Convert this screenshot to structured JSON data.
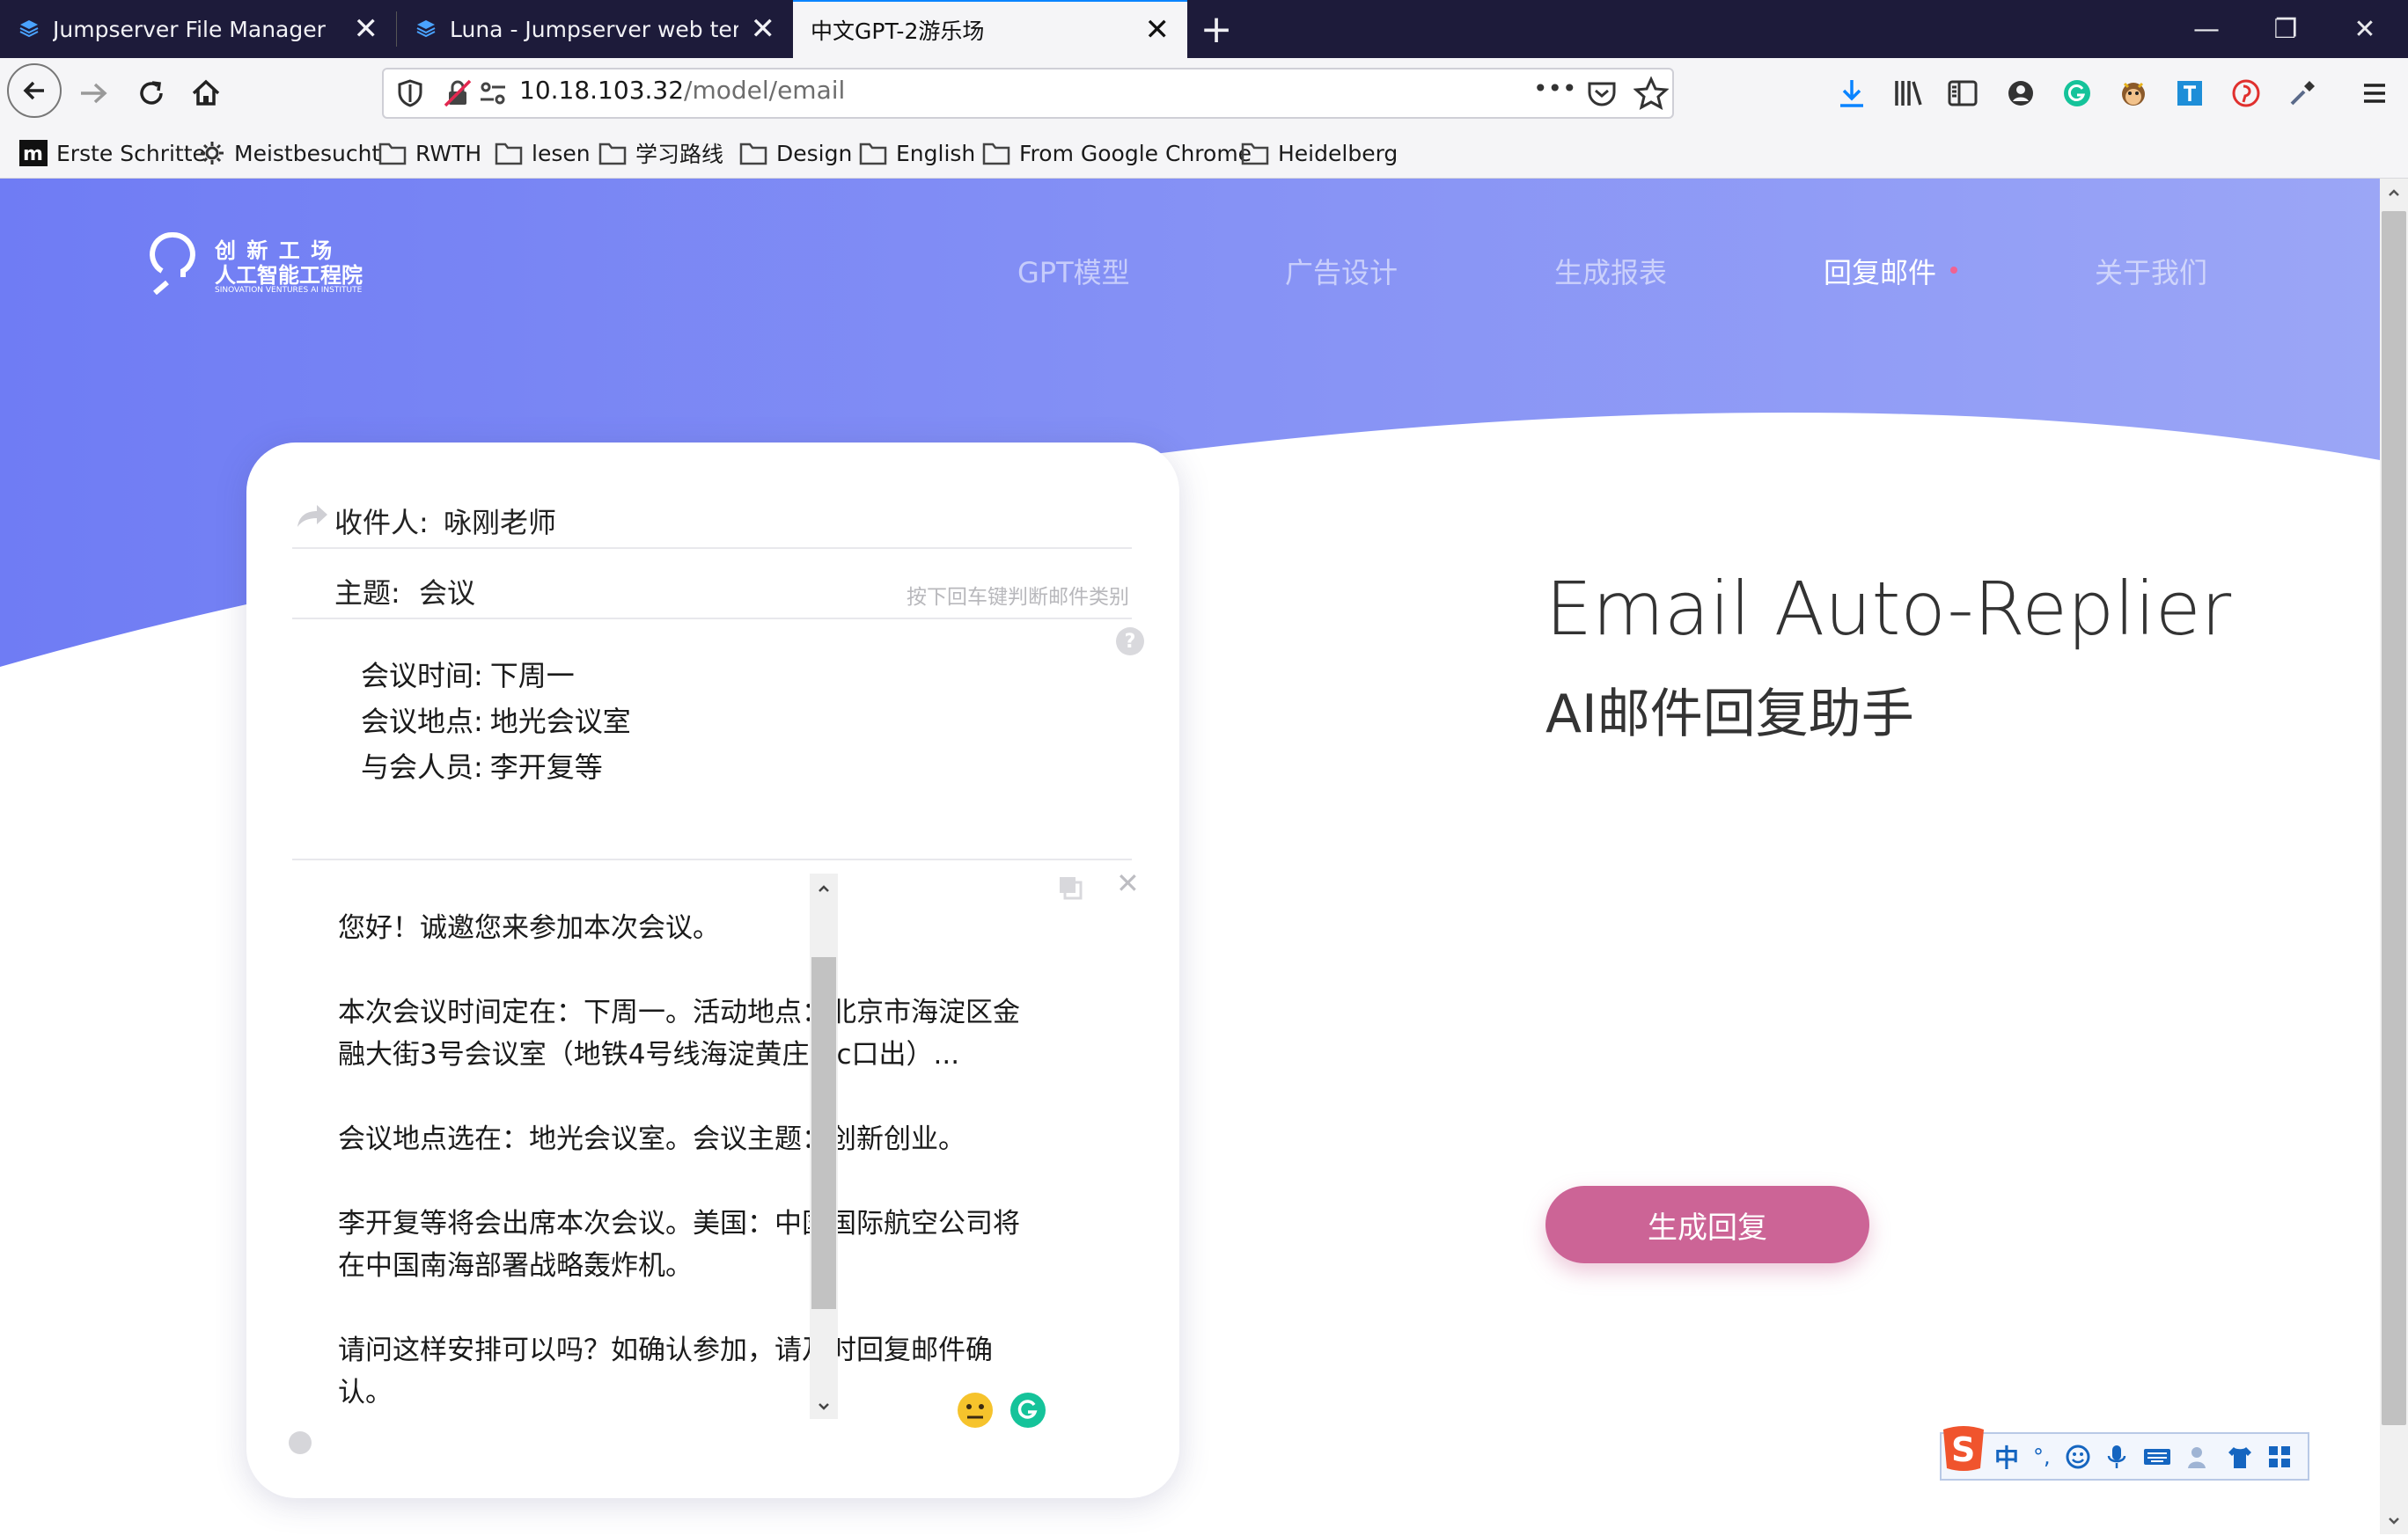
{
  "browser": {
    "tabs": [
      {
        "label": "Jumpserver File Manager",
        "close": "✕",
        "active": false
      },
      {
        "label": "Luna - Jumpserver web terminal",
        "close": "✕",
        "active": false
      },
      {
        "label": "中文GPT-2游乐场",
        "close": "✕",
        "active": true
      }
    ],
    "new_tab": "+",
    "window_controls": {
      "minimize": "—",
      "restore": "❐",
      "close": "✕"
    },
    "url": {
      "host": "10.18.103.32",
      "path": "/model/email"
    },
    "url_more": "•••",
    "bookmarks": [
      {
        "label": "Erste Schritte",
        "icon": "mozilla-icon"
      },
      {
        "label": "Meistbesucht",
        "icon": "gear-icon"
      },
      {
        "label": "RWTH",
        "icon": "folder-icon"
      },
      {
        "label": "lesen",
        "icon": "folder-icon"
      },
      {
        "label": "学习路线",
        "icon": "folder-icon"
      },
      {
        "label": "Design",
        "icon": "folder-icon"
      },
      {
        "label": "English",
        "icon": "folder-icon"
      },
      {
        "label": "From Google Chrome",
        "icon": "folder-icon"
      },
      {
        "label": "Heidelberg",
        "icon": "folder-icon"
      }
    ]
  },
  "site": {
    "logo": {
      "line1": "创 新 工 场",
      "line2": "人工智能工程院",
      "line3": "SINOVATION VENTURES AI INSTITUTE"
    },
    "menu": [
      {
        "label": "GPT模型",
        "active": false
      },
      {
        "label": "广告设计",
        "active": false
      },
      {
        "label": "生成报表",
        "active": false
      },
      {
        "label": "回复邮件",
        "active": true
      },
      {
        "label": "关于我们",
        "active": false
      }
    ],
    "colors": {
      "header_gradient_start": "#6f7cf4",
      "header_gradient_end": "#9ba6f6",
      "button": "#cc6496",
      "active_dot": "#f06292"
    }
  },
  "email": {
    "recipient_label": "收件人:",
    "recipient": "咏刚老师",
    "subject_label": "主题:",
    "subject": "会议",
    "subject_hint": "按下回车键判断邮件类别",
    "help": "?",
    "info_lines": [
      {
        "label": "会议时间:",
        "value": "下周一"
      },
      {
        "label": "会议地点:",
        "value": "地光会议室"
      },
      {
        "label": "与会人员:",
        "value": "李开复等"
      }
    ],
    "reply_lines": [
      "您好！诚邀您来参加本次会议。",
      "",
      "本次会议时间定在：下周一。活动地点：北京市海淀区金",
      "融大街3号会议室（地铁4号线海淀黄庄站c口出）...",
      "",
      "会议地点选在：地光会议室。会议主题：创新创业。",
      "",
      "李开复等将会出席本次会议。美国：中国国际航空公司将",
      "在中国南海部署战略轰炸机。",
      "",
      "请问这样安排可以吗？如确认参加，请及时回复邮件确",
      "认。"
    ],
    "close": "✕"
  },
  "hero": {
    "title": "Email Auto-Replier",
    "subtitle": "AI邮件回复助手",
    "button": "生成回复"
  },
  "ime": {
    "logo": "S",
    "mode": "中",
    "punct": "°,"
  }
}
